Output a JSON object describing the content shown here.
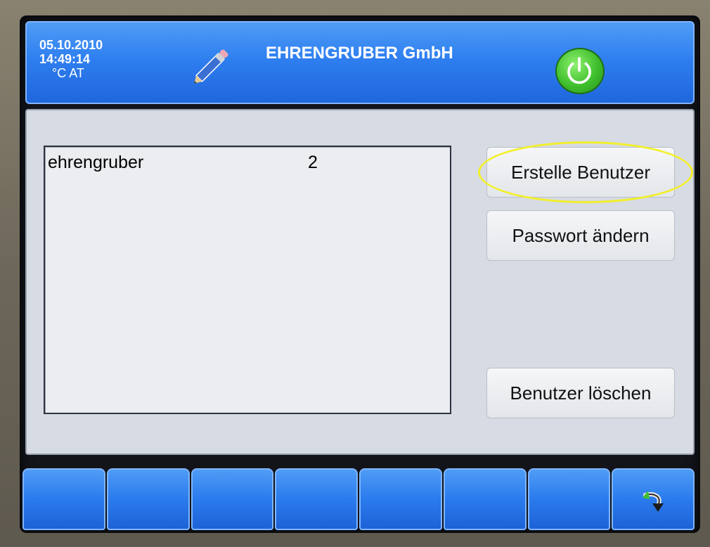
{
  "header": {
    "date": "05.10.2010",
    "time": "14:49:14",
    "units": "°C  AT",
    "title": "EHRENGRUBER GmbH",
    "edit_icon": "pencil-icon",
    "power_icon": "power-icon",
    "accent_color": "#2f7ff0"
  },
  "user_list": {
    "rows": [
      {
        "name": "ehrengruber",
        "level": "2"
      }
    ]
  },
  "actions": {
    "create_user": "Erstelle Benutzer",
    "change_password": "Passwort ändern",
    "delete_user": "Benutzer löschen"
  },
  "function_keys": {
    "count": 8,
    "last_icon": "back-arrow-icon"
  }
}
